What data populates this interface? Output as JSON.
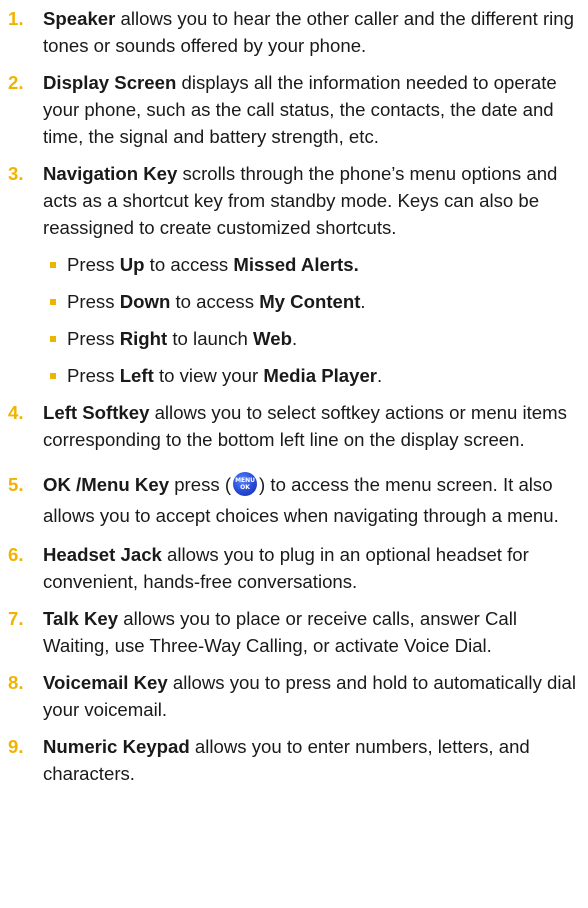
{
  "items": [
    {
      "num": "1.",
      "term": "Speaker",
      "desc": " allows you to hear the other caller and the different ring tones or sounds offered by your phone."
    },
    {
      "num": "2.",
      "term": "Display Screen",
      "desc": " displays all the information needed to operate your phone, such as the call status, the contacts, the date and time, the signal and battery strength, etc."
    },
    {
      "num": "3.",
      "term": "Navigation Key",
      "desc": " scrolls through the phone’s menu options and acts as a shortcut key from standby mode. Keys can also be reassigned to create customized shortcuts."
    },
    {
      "num": "4.",
      "term": "Left Softkey",
      "desc": " allows you to select softkey actions or menu items corresponding to the bottom left line on the display screen."
    },
    {
      "num": "5.",
      "term": "OK /Menu Key",
      "desc_before": " press (",
      "desc_after": ") to access the menu screen. It also allows you to accept choices when navigating through a menu."
    },
    {
      "num": "6.",
      "term": "Headset Jack",
      "desc": " allows you to plug in an optional headset for convenient, hands-free conversations."
    },
    {
      "num": "7.",
      "term": "Talk Key",
      "desc": " allows you to place or receive calls, answer Call Waiting, use Three-Way Calling, or activate Voice Dial."
    },
    {
      "num": "8.",
      "term": "Voicemail Key",
      "desc": " allows you to press and hold to automatically dial your voicemail."
    },
    {
      "num": "9.",
      "term": "Numeric Keypad",
      "desc": " allows you to enter numbers, letters, and characters."
    }
  ],
  "nav_bullets": [
    {
      "press": "Press ",
      "dir": "Up",
      "mid": " to access ",
      "target": "Missed Alerts.",
      "end": ""
    },
    {
      "press": "Press ",
      "dir": "Down",
      "mid": " to access ",
      "target": "My Content",
      "end": "."
    },
    {
      "press": "Press ",
      "dir": "Right",
      "mid": " to launch ",
      "target": "Web",
      "end": "."
    },
    {
      "press": "Press ",
      "dir": "Left",
      "mid": " to view your ",
      "target": "Media Player",
      "end": "."
    }
  ],
  "ok_icon": {
    "line1": "MENU",
    "line2": "OK",
    "color": "#2749d6"
  },
  "colors": {
    "accent": "#f0b400",
    "text": "#1a1a1a"
  }
}
